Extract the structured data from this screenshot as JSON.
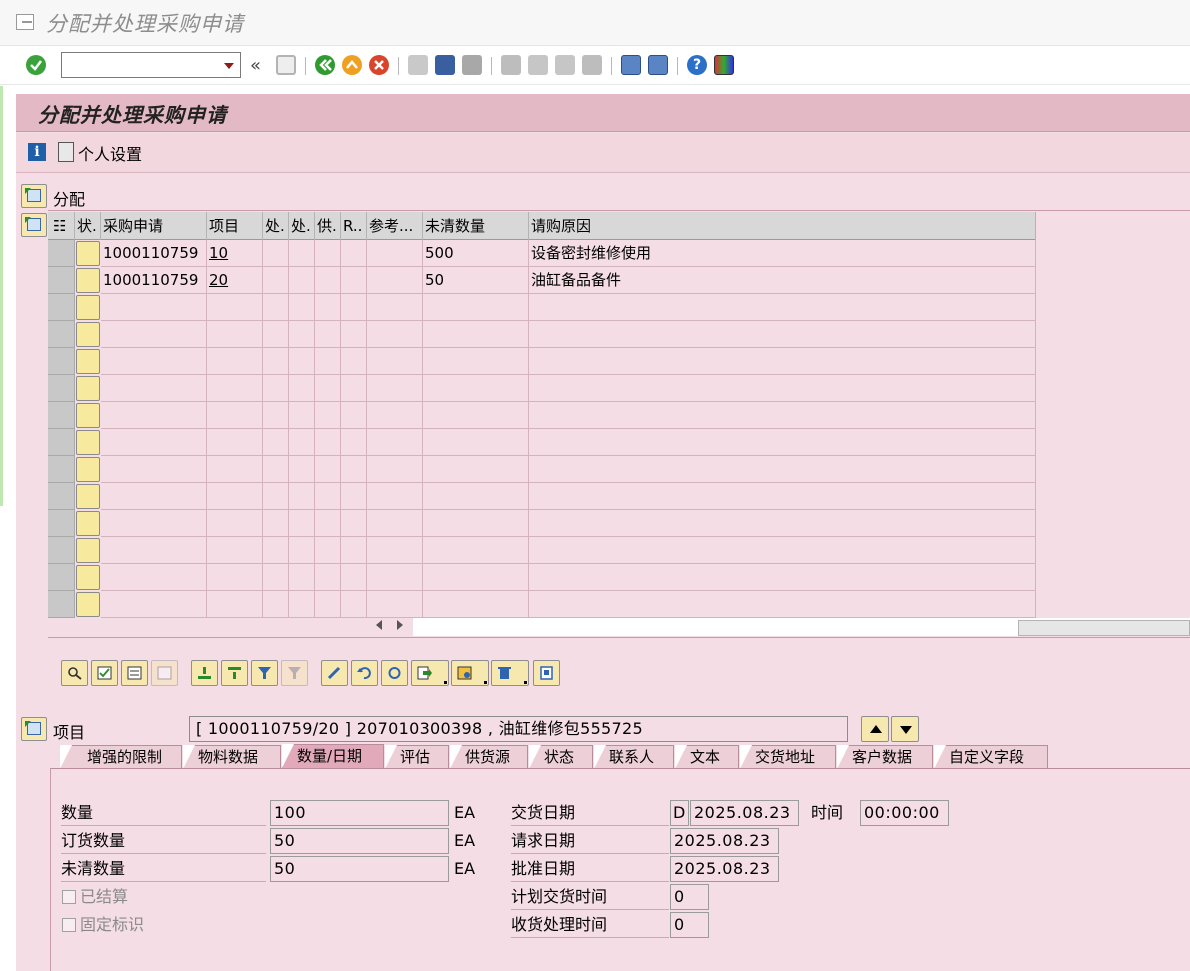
{
  "window": {
    "title": "分配并处理采购申请"
  },
  "toolbar": {
    "command_field": "",
    "back_label": "«"
  },
  "app": {
    "header": "分配并处理采购申请",
    "personal_settings": "个人设置"
  },
  "section": {
    "assign_label": "分配"
  },
  "grid": {
    "columns": [
      "状.",
      "采购申请",
      "项目",
      "处.",
      "处.",
      "供.",
      "R..",
      "参考...",
      "未清数量",
      "请购原因"
    ],
    "rows": [
      {
        "pr": "1000110759",
        "item": "10",
        "open_qty": "500",
        "reason": "设备密封维修使用"
      },
      {
        "pr": "1000110759",
        "item": "20",
        "open_qty": "50",
        "reason": "油缸备品备件"
      }
    ]
  },
  "item": {
    "label": "项目",
    "value": "[ 1000110759/20 ] 207010300398 , 油缸维修包555725"
  },
  "tabs": [
    {
      "label": "增强的限制"
    },
    {
      "label": "物料数据"
    },
    {
      "label": "数量/日期",
      "active": true
    },
    {
      "label": "评估"
    },
    {
      "label": "供货源"
    },
    {
      "label": "状态"
    },
    {
      "label": "联系人"
    },
    {
      "label": "文本"
    },
    {
      "label": "交货地址"
    },
    {
      "label": "客户数据"
    },
    {
      "label": "自定义字段"
    }
  ],
  "qty": {
    "quantity_label": "数量",
    "quantity": "100",
    "quantity_unit": "EA",
    "ordered_label": "订货数量",
    "ordered": "50",
    "ordered_unit": "EA",
    "open_label": "未清数量",
    "open": "50",
    "open_unit": "EA",
    "settled_label": "已结算",
    "fixed_label": "固定标识"
  },
  "dates": {
    "delivery_label": "交货日期",
    "delivery_type": "D",
    "delivery": "2025.08.23",
    "time_label": "时间",
    "time": "00:00:00",
    "request_label": "请求日期",
    "request": "2025.08.23",
    "approval_label": "批准日期",
    "approval": "2025.08.23",
    "planned_label": "计划交货时间",
    "planned": "0",
    "gr_label": "收货处理时间",
    "gr": "0"
  }
}
